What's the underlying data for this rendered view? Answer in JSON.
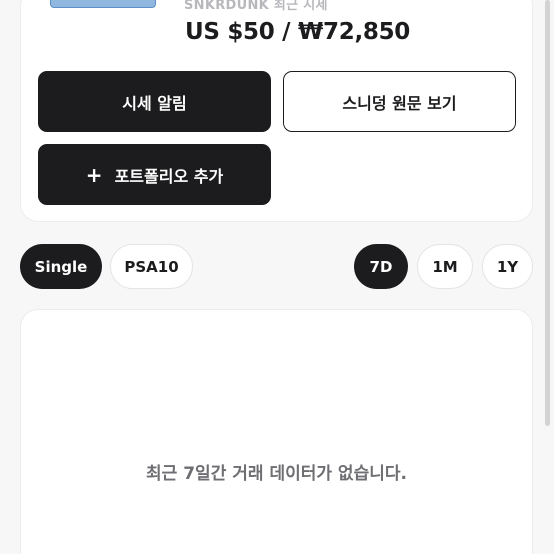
{
  "product": {
    "source_line": "SNKRDUNK 최근 시세",
    "price": "US $50 / ₩72,850"
  },
  "actions": {
    "alert_label": "시세 알림",
    "origin_label": "스니덩 원문 보기",
    "portfolio_icon": "+",
    "portfolio_label": "포트폴리오 추가"
  },
  "grade_filters": [
    {
      "label": "Single",
      "active": true
    },
    {
      "label": "PSA10",
      "active": false
    }
  ],
  "period_filters": [
    {
      "label": "7D",
      "active": true
    },
    {
      "label": "1M",
      "active": false
    },
    {
      "label": "1Y",
      "active": false
    }
  ],
  "chart": {
    "empty_message": "최근 7일간 거래 데이터가 없습니다."
  },
  "colors": {
    "primary": "#1c1c1e",
    "background": "#f7f7f7",
    "card": "#ffffff"
  }
}
